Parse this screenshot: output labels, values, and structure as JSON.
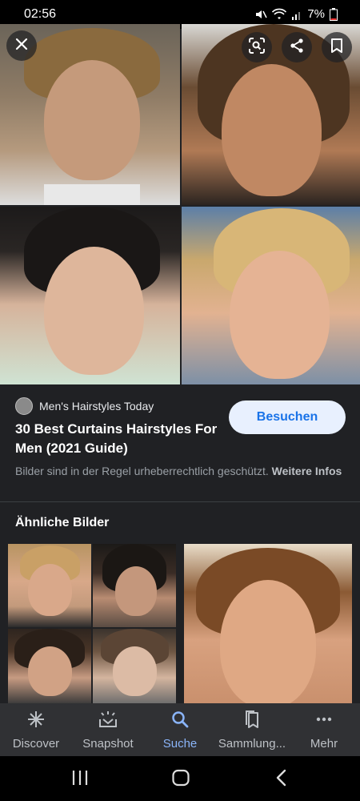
{
  "status_bar": {
    "time": "02:56",
    "battery": "7%"
  },
  "result": {
    "source_name": "Men's Hairstyles Today",
    "title": "30 Best Curtains Hairstyles For Men (2021 Guide)",
    "visit_label": "Besuchen",
    "copyright_text": "Bilder sind in der Regel urheberrechtlich geschützt.",
    "more_info_label": "Weitere Infos"
  },
  "similar": {
    "heading": "Ähnliche Bilder"
  },
  "bottom_nav": {
    "items": [
      {
        "label": "Discover",
        "icon": "asterisk-icon"
      },
      {
        "label": "Snapshot",
        "icon": "snapshot-icon"
      },
      {
        "label": "Suche",
        "icon": "search-icon",
        "active": true
      },
      {
        "label": "Sammlung...",
        "icon": "collections-icon"
      },
      {
        "label": "Mehr",
        "icon": "more-icon"
      }
    ]
  },
  "colors": {
    "background": "#202124",
    "accent": "#8ab4f8",
    "visit_button_bg": "#e8f0fe",
    "visit_button_text": "#1a73e8"
  }
}
